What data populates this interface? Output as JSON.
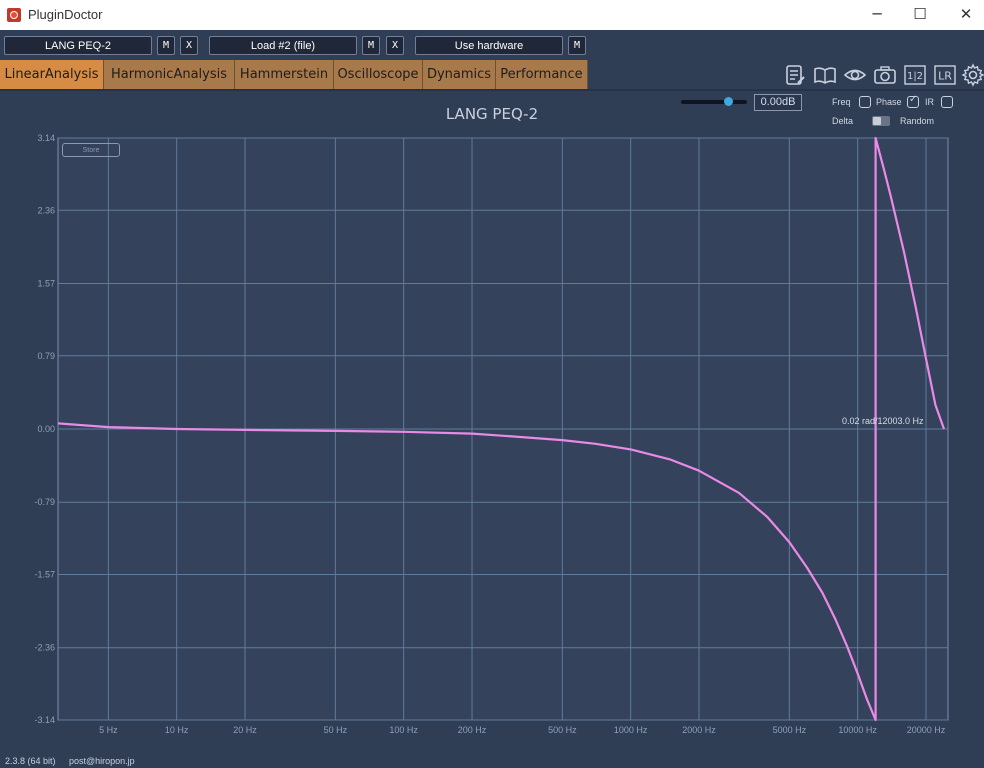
{
  "window": {
    "title": "PluginDoctor",
    "minimize": "─",
    "maximize": "☐",
    "close": "✕"
  },
  "toolbar": {
    "plugin_a": "LANG PEQ-2",
    "m_label": "M",
    "x_label": "X",
    "plugin_b": "Load #2 (file)",
    "hardware": "Use hardware"
  },
  "tabs": [
    "LinearAnalysis",
    "HarmonicAnalysis",
    "Hammerstein",
    "Oscilloscope",
    "Dynamics",
    "Performance"
  ],
  "active_tab": 0,
  "tool_icons": [
    "notes-icon",
    "book-icon",
    "eye-icon",
    "camera-icon",
    "one-two-icon",
    "lr-icon",
    "gear-icon"
  ],
  "tool_text": {
    "one_two": "1|2",
    "lr": "LR"
  },
  "controls": {
    "gain": "0.00dB",
    "freq_label": "Freq",
    "phase_label": "Phase",
    "ir_label": "IR",
    "delta_label": "Delta",
    "random_label": "Random",
    "freq_checked": false,
    "phase_checked": true,
    "ir_checked": false
  },
  "store_label": "Store",
  "readout": "0.02 rad/12003.0 Hz",
  "status": {
    "version": "2.3.8 (64 bit)",
    "email": "post@hiropon.jp"
  },
  "chart_data": {
    "type": "line",
    "title": "LANG PEQ-2",
    "xscale": "log",
    "xlim": [
      3,
      25000
    ],
    "ylim": [
      -3.14,
      3.14
    ],
    "grid": true,
    "x_ticks": [
      5,
      10,
      20,
      50,
      100,
      200,
      500,
      1000,
      2000,
      5000,
      10000,
      20000
    ],
    "x_tick_labels": [
      "5 Hz",
      "10 Hz",
      "20 Hz",
      "50 Hz",
      "100 Hz",
      "200 Hz",
      "500 Hz",
      "1000 Hz",
      "2000 Hz",
      "5000 Hz",
      "10000 Hz",
      "20000 Hz"
    ],
    "y_ticks": [
      3.14,
      2.36,
      1.57,
      0.79,
      0.0,
      -0.79,
      -1.57,
      -2.36,
      -3.14
    ],
    "y_tick_labels": [
      "3.14",
      "2.36",
      "1.57",
      "0.79",
      "0.00",
      "-0.79",
      "-1.57",
      "-2.36",
      "-3.14"
    ],
    "series": [
      {
        "color": "#e98ae6",
        "x": [
          3,
          5,
          10,
          20,
          50,
          100,
          200,
          300,
          500,
          700,
          1000,
          1500,
          2000,
          3000,
          4000,
          5000,
          6000,
          7000,
          8000,
          9000,
          10000,
          11000,
          12000,
          12000,
          13000,
          14000,
          16000,
          18000,
          20000,
          22000,
          24000
        ],
        "y": [
          0.06,
          0.02,
          0.0,
          -0.01,
          -0.02,
          -0.03,
          -0.05,
          -0.08,
          -0.12,
          -0.16,
          -0.22,
          -0.33,
          -0.45,
          -0.69,
          -0.95,
          -1.22,
          -1.5,
          -1.77,
          -2.06,
          -2.35,
          -2.64,
          -2.92,
          -3.14,
          3.14,
          2.82,
          2.51,
          1.91,
          1.32,
          0.76,
          0.26,
          0.0
        ]
      }
    ]
  }
}
